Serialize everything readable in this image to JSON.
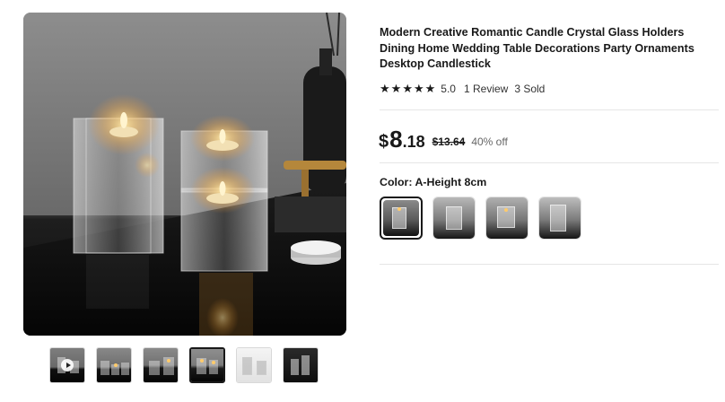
{
  "product": {
    "title": "Modern Creative Romantic Candle Crystal Glass Holders Dining Home Wedding Table Decorations Party Ornaments Desktop Candlestick",
    "rating": {
      "stars_filled": 5,
      "star_icon": "star-icon",
      "score": "5.0",
      "reviews": "1 Review",
      "sold": "3 Sold"
    },
    "price": {
      "currency": "$",
      "integer": "8",
      "decimal": ".18",
      "original": "$13.64",
      "discount": "40% off"
    },
    "color": {
      "label": "Color: A-Height 8cm",
      "selected_index": 0,
      "options": [
        "A-Height 8cm",
        "option-2",
        "option-3",
        "option-4"
      ]
    }
  },
  "gallery": {
    "thumbnails": [
      {
        "kind": "video",
        "icon": "play-icon"
      },
      {
        "kind": "image"
      },
      {
        "kind": "image"
      },
      {
        "kind": "image",
        "active": true
      },
      {
        "kind": "image"
      },
      {
        "kind": "image"
      }
    ]
  },
  "colors": {
    "text": "#191919",
    "divider": "#e6e6e6",
    "muted": "#666666"
  }
}
